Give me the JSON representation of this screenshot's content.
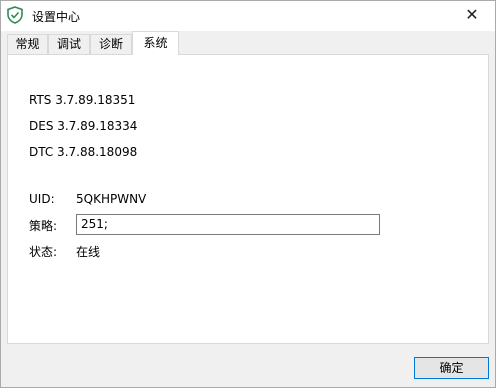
{
  "window": {
    "title": "设置中心",
    "close_glyph": "✕",
    "icon": "shield-check-icon",
    "accent": "#0078d7"
  },
  "tabs": [
    {
      "label": "常规",
      "active": false
    },
    {
      "label": "调试",
      "active": false
    },
    {
      "label": "诊断",
      "active": false
    },
    {
      "label": "系统",
      "active": true
    }
  ],
  "versions": [
    "RTS 3.7.89.18351",
    "DES 3.7.89.18334",
    "DTC 3.7.88.18098"
  ],
  "info": {
    "uid_label": "UID:",
    "uid_value": "5QKHPWNV",
    "policy_label": "策略:",
    "policy_value": "251;",
    "status_label": "状态:",
    "status_value": "在线"
  },
  "footer": {
    "ok_label": "确定"
  }
}
